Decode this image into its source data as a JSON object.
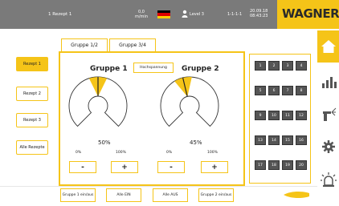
{
  "header": {
    "recipe": "1 Rezept 1",
    "speed_value": "0,0",
    "speed_unit": "m/min",
    "level": "Level 3",
    "counter": "1-1-1-1",
    "date": "20.09.18",
    "time": "08:43:23",
    "logo": "WAGNER"
  },
  "tabs": [
    {
      "label": "Gruppe 1/2",
      "active": true
    },
    {
      "label": "Gruppe 3/4",
      "active": false
    }
  ],
  "left_buttons": [
    {
      "label": "Rezept 1",
      "active": true
    },
    {
      "label": "Rezept 2",
      "active": false
    },
    {
      "label": "Rezept 3",
      "active": false
    },
    {
      "label": "Alle Rezepte",
      "active": false
    }
  ],
  "groups": [
    {
      "title": "Gruppe 1",
      "percent": "50%",
      "value": 50,
      "min": "0%",
      "max": "100%",
      "minus": "-",
      "plus": "+"
    },
    {
      "title": "Gruppe 2",
      "percent": "45%",
      "value": 45,
      "min": "0%",
      "max": "100%",
      "minus": "-",
      "plus": "+"
    }
  ],
  "hochspannung": "Hochspannung",
  "grid_cells": [
    "1",
    "2",
    "3",
    "4",
    "5",
    "6",
    "7",
    "8",
    "9",
    "10",
    "11",
    "12",
    "13",
    "14",
    "15",
    "16",
    "17",
    "18",
    "19",
    "20"
  ],
  "bottom_buttons": [
    {
      "label": "Gruppe 1 ein/aus"
    },
    {
      "label": "Alle EIN"
    },
    {
      "label": "Alle AUS"
    },
    {
      "label": "Gruppe 2 ein/aus"
    }
  ],
  "colors": {
    "accent": "#f5c418",
    "header": "#7a7a7a",
    "cell": "#555555"
  },
  "icons": {
    "sidebar": [
      "home-icon",
      "chart-bars-icon",
      "spray-gun-icon",
      "settings-gear-icon",
      "alarm-light-icon"
    ],
    "bottom_right": "spray-shape-icon"
  }
}
